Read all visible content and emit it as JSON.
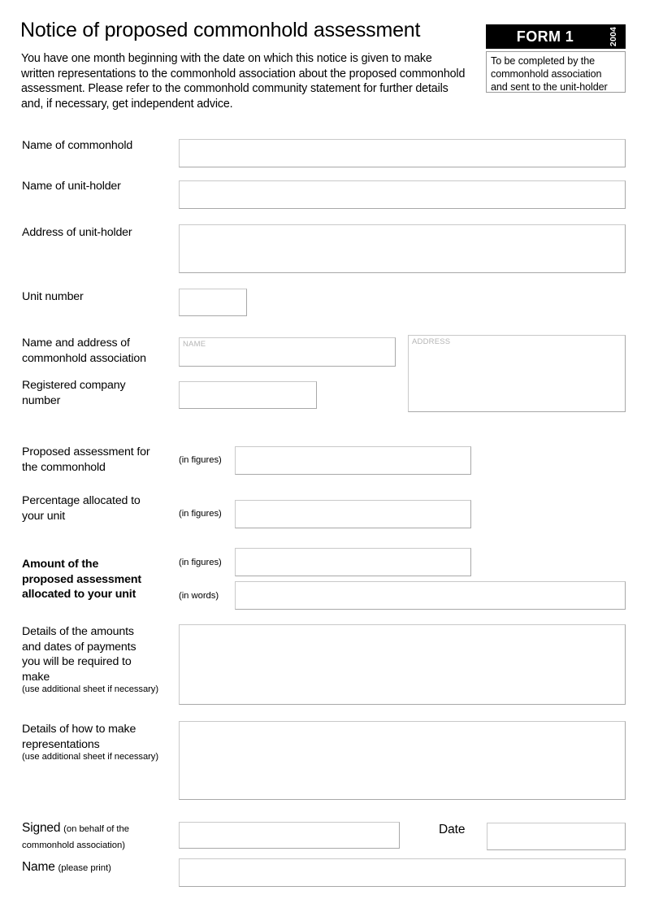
{
  "header": {
    "title": "Notice of proposed commonhold assessment",
    "intro": "You have one month beginning with the date on which this notice is given to make written representations to the commonhold association about the proposed commonhold assessment. Please refer to the commonhold community statement for further details and, if necessary, get independent advice.",
    "badge_label": "FORM 1",
    "badge_year": "2004",
    "note": "To be completed by the commonhold association and sent to the unit-holder"
  },
  "fields": {
    "name_of_commonhold": {
      "label": "Name of commonhold",
      "value": ""
    },
    "name_of_unit_holder": {
      "label": "Name of unit-holder",
      "value": ""
    },
    "address_of_unit_holder": {
      "label": "Address of unit-holder",
      "value": ""
    },
    "unit_number": {
      "label": "Unit number",
      "value": ""
    },
    "association_name_address": {
      "label_line1": "Name and address of",
      "label_line2": "commonhold association",
      "name_placeholder": "NAME",
      "name_value": "",
      "address_placeholder": "ADDRESS",
      "address_value": ""
    },
    "registered_company_number": {
      "label_line1": "Registered company",
      "label_line2": "number",
      "value": ""
    },
    "proposed_assessment": {
      "label_line1": "Proposed assessment for",
      "label_line2": "the commonhold",
      "note": "(in figures)",
      "value": ""
    },
    "percentage_allocated": {
      "label_line1": "Percentage allocated to",
      "label_line2": "your unit",
      "note": "(in figures)",
      "value": ""
    },
    "amount_allocated": {
      "label_line1": "Amount of the",
      "label_line2": "proposed assessment",
      "label_line3": "allocated to your unit",
      "note_figures": "(in figures)",
      "value_figures": "",
      "note_words": "(in words)",
      "value_words": ""
    },
    "payment_details": {
      "label_line1": "Details of the amounts",
      "label_line2": "and dates of payments",
      "label_line3": "you will be required to",
      "label_line4": "make",
      "sub": "(use additional sheet if necessary)",
      "value": ""
    },
    "representations_details": {
      "label_line1": "Details of how to make",
      "label_line2": "representations",
      "sub": "(use additional sheet if necessary)",
      "value": ""
    },
    "signed": {
      "label": "Signed",
      "note_line1": "(on behalf of the",
      "note_line2": "commonhold association)",
      "value": ""
    },
    "date": {
      "label": "Date",
      "value": ""
    },
    "name_print": {
      "label": "Name",
      "note": "(please print)",
      "value": ""
    }
  },
  "colors": {
    "badge_background": "#000000",
    "badge_text": "#ffffff",
    "box_border": "#a8a8a8",
    "placeholder_text": "#b5b5b5",
    "page_background": "#ffffff"
  }
}
